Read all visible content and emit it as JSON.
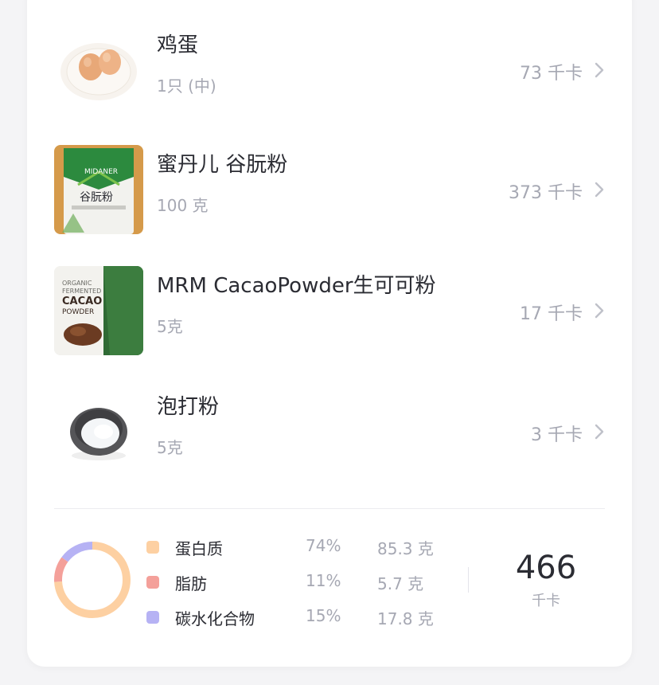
{
  "foods": [
    {
      "name": "鸡蛋",
      "amount": "1只 (中)",
      "calories": "73 千卡",
      "icon": "eggs-on-plate"
    },
    {
      "name": "蜜丹儿 谷朊粉",
      "amount": "100 克",
      "calories": "373 千卡",
      "icon": "gluten-flour-bag",
      "package_text": [
        "MIDANER",
        "谷朊粉"
      ]
    },
    {
      "name": "MRM CacaoPowder生可可粉",
      "amount": "5克",
      "calories": "17 千卡",
      "icon": "cacao-powder-bag",
      "package_text": [
        "ORGANIC",
        "FERMENTED",
        "CACAO",
        "POWDER"
      ]
    },
    {
      "name": "泡打粉",
      "amount": "5克",
      "calories": "3 千卡",
      "icon": "baking-powder-bowl"
    }
  ],
  "macros": [
    {
      "name": "蛋白质",
      "percent": "74%",
      "amount": "85.3 克",
      "ratio": 0.74,
      "color": "#fdd0a2"
    },
    {
      "name": "脂肪",
      "percent": "11%",
      "amount": "5.7 克",
      "ratio": 0.11,
      "color": "#f4a09a"
    },
    {
      "name": "碳水化合物",
      "percent": "15%",
      "amount": "17.8 克",
      "ratio": 0.15,
      "color": "#b6b2f4"
    }
  ],
  "total": {
    "value": "466",
    "unit": "千卡"
  }
}
